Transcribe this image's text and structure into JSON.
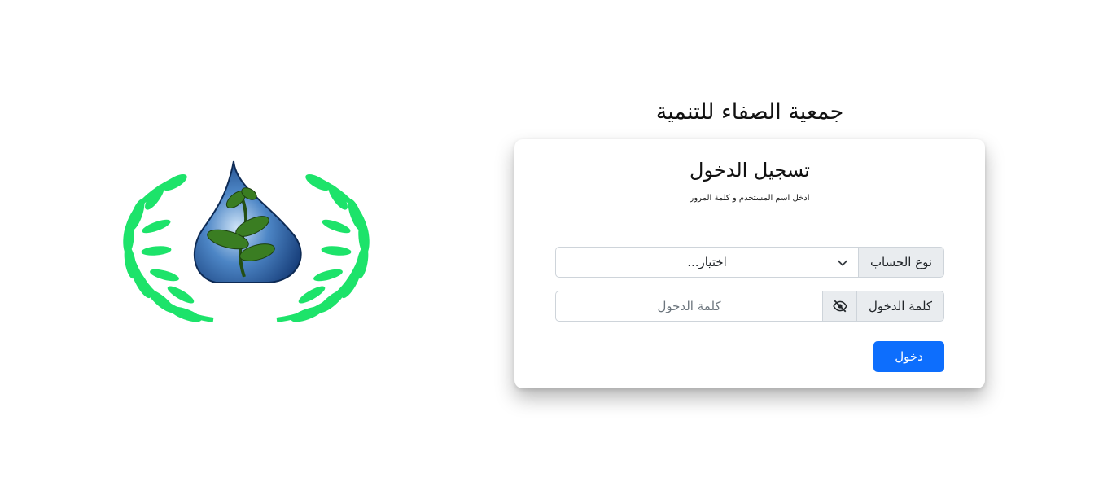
{
  "org_title": "جمعية الصفاء للتنمية",
  "login_card": {
    "title": "تسجيل الدخول",
    "subtitle": "ادخل اسم المستخدم و كلمة المرور",
    "account_type": {
      "label": "نوع الحساب",
      "selected": "اختيار..."
    },
    "password": {
      "label": "كلمة الدخول",
      "placeholder": "كلمة الدخول",
      "toggle_icon": "eye-slash-icon"
    },
    "submit_label": "دخول"
  },
  "logo": {
    "icon": "water-drop-plant-laurel-logo"
  },
  "colors": {
    "primary": "#0d6efd",
    "addon_bg": "#e9ecef",
    "border": "#ced4da",
    "laurel": "#1de36a"
  }
}
